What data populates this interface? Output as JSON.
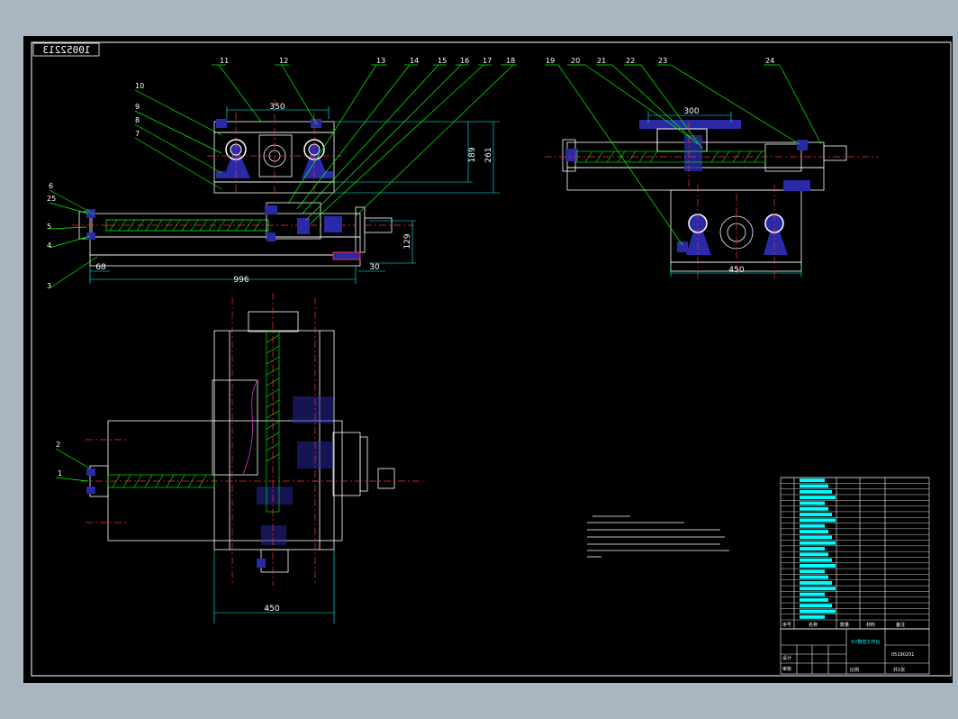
{
  "drawing_number": "10052213",
  "colors": {
    "background": "#000000",
    "frame": "#ffffff",
    "part": "#2a2aa8",
    "leader": "#00ff00",
    "center": "#ff3030",
    "dimension": "#00ffff",
    "title_text": "#00ffff"
  },
  "part_labels": [
    "1",
    "2",
    "3",
    "4",
    "5",
    "6",
    "7",
    "8",
    "9",
    "10",
    "11",
    "12",
    "13",
    "14",
    "15",
    "16",
    "17",
    "18",
    "19",
    "20",
    "21",
    "22",
    "23",
    "24",
    "25"
  ],
  "dimensions": {
    "d350": "350",
    "d189": "189",
    "d261": "261",
    "d129": "129",
    "d996": "996",
    "d68": "68",
    "d30": "30",
    "d300": "300",
    "d450_side": "450",
    "d450_top": "450"
  },
  "title_block": {
    "name": "X-Y数控工作台",
    "code": "05190201",
    "sheet": "共1张",
    "design": "设计",
    "check": "审核",
    "scale": "比例"
  },
  "bom_header": {
    "index": "序号",
    "name": "名称",
    "qty": "数量",
    "material": "材料",
    "note": "备注"
  }
}
